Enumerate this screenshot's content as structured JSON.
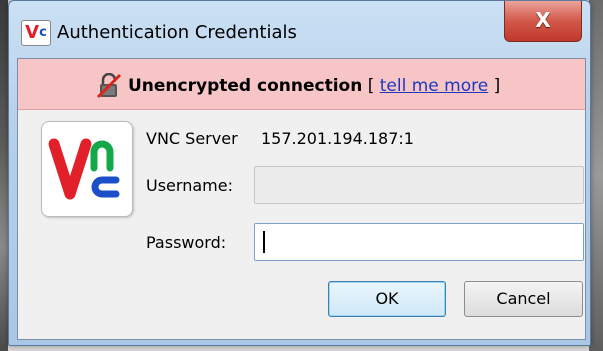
{
  "window": {
    "title": "Authentication Credentials",
    "close_label": "X"
  },
  "warning": {
    "text": "Unencrypted connection",
    "bracket_open": "[",
    "link": "tell me more",
    "bracket_close": "]"
  },
  "server": {
    "label": "VNC Server",
    "value": "157.201.194.187:1"
  },
  "username": {
    "label": "Username:",
    "value": ""
  },
  "password": {
    "label": "Password:",
    "value": ""
  },
  "buttons": {
    "ok": "OK",
    "cancel": "Cancel"
  },
  "colors": {
    "warning_background": "#f7c5c5",
    "link": "#1a38c0",
    "vnc_red": "#e2202a",
    "vnc_blue": "#1b4fc8",
    "close_button": "#c0392b"
  },
  "icons": {
    "app": "vnc-logo-icon",
    "warning": "unlocked-padlock-icon",
    "close": "close-icon"
  }
}
